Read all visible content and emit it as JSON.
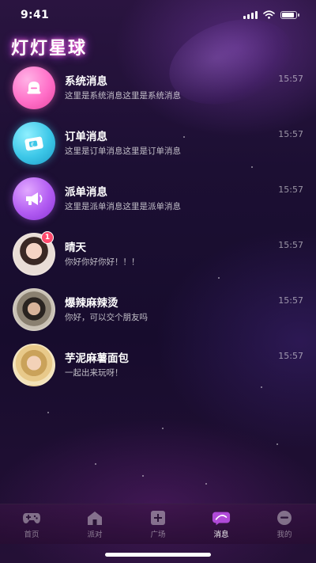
{
  "status_bar": {
    "time": "9:41"
  },
  "header": {
    "title": "灯灯星球"
  },
  "messages": [
    {
      "name": "系统消息",
      "preview": "这里是系统消息这里是系统消息",
      "time": "15:57",
      "avatar": "bell-icon"
    },
    {
      "name": "订单消息",
      "preview": "这里是订单消息这里是订单消息",
      "time": "15:57",
      "avatar": "ticket-icon"
    },
    {
      "name": "派单消息",
      "preview": "这里是派单消息这里是派单消息",
      "time": "15:57",
      "avatar": "megaphone-icon"
    },
    {
      "name": "晴天",
      "preview": "你好你好你好！！！",
      "time": "15:57",
      "avatar": "user-photo",
      "badge": "1"
    },
    {
      "name": "爆辣麻辣烫",
      "preview": "你好，可以交个朋友吗",
      "time": "15:57",
      "avatar": "user-photo"
    },
    {
      "name": "芋泥麻薯面包",
      "preview": "一起出来玩呀！",
      "time": "15:57",
      "avatar": "user-photo"
    }
  ],
  "tabs": [
    {
      "label": "首页",
      "icon": "gamepad-icon",
      "active": false
    },
    {
      "label": "派对",
      "icon": "house-icon",
      "active": false
    },
    {
      "label": "广场",
      "icon": "plus-square-icon",
      "active": false
    },
    {
      "label": "消息",
      "icon": "chat-icon",
      "active": true
    },
    {
      "label": "我的",
      "icon": "profile-icon",
      "active": false
    }
  ],
  "colors": {
    "title_glow": "#ff6ad5",
    "system": "#ff6fc8",
    "order": "#3cc7e8",
    "dispatch": "#b25cf2",
    "badge": "#ff4a6e"
  }
}
